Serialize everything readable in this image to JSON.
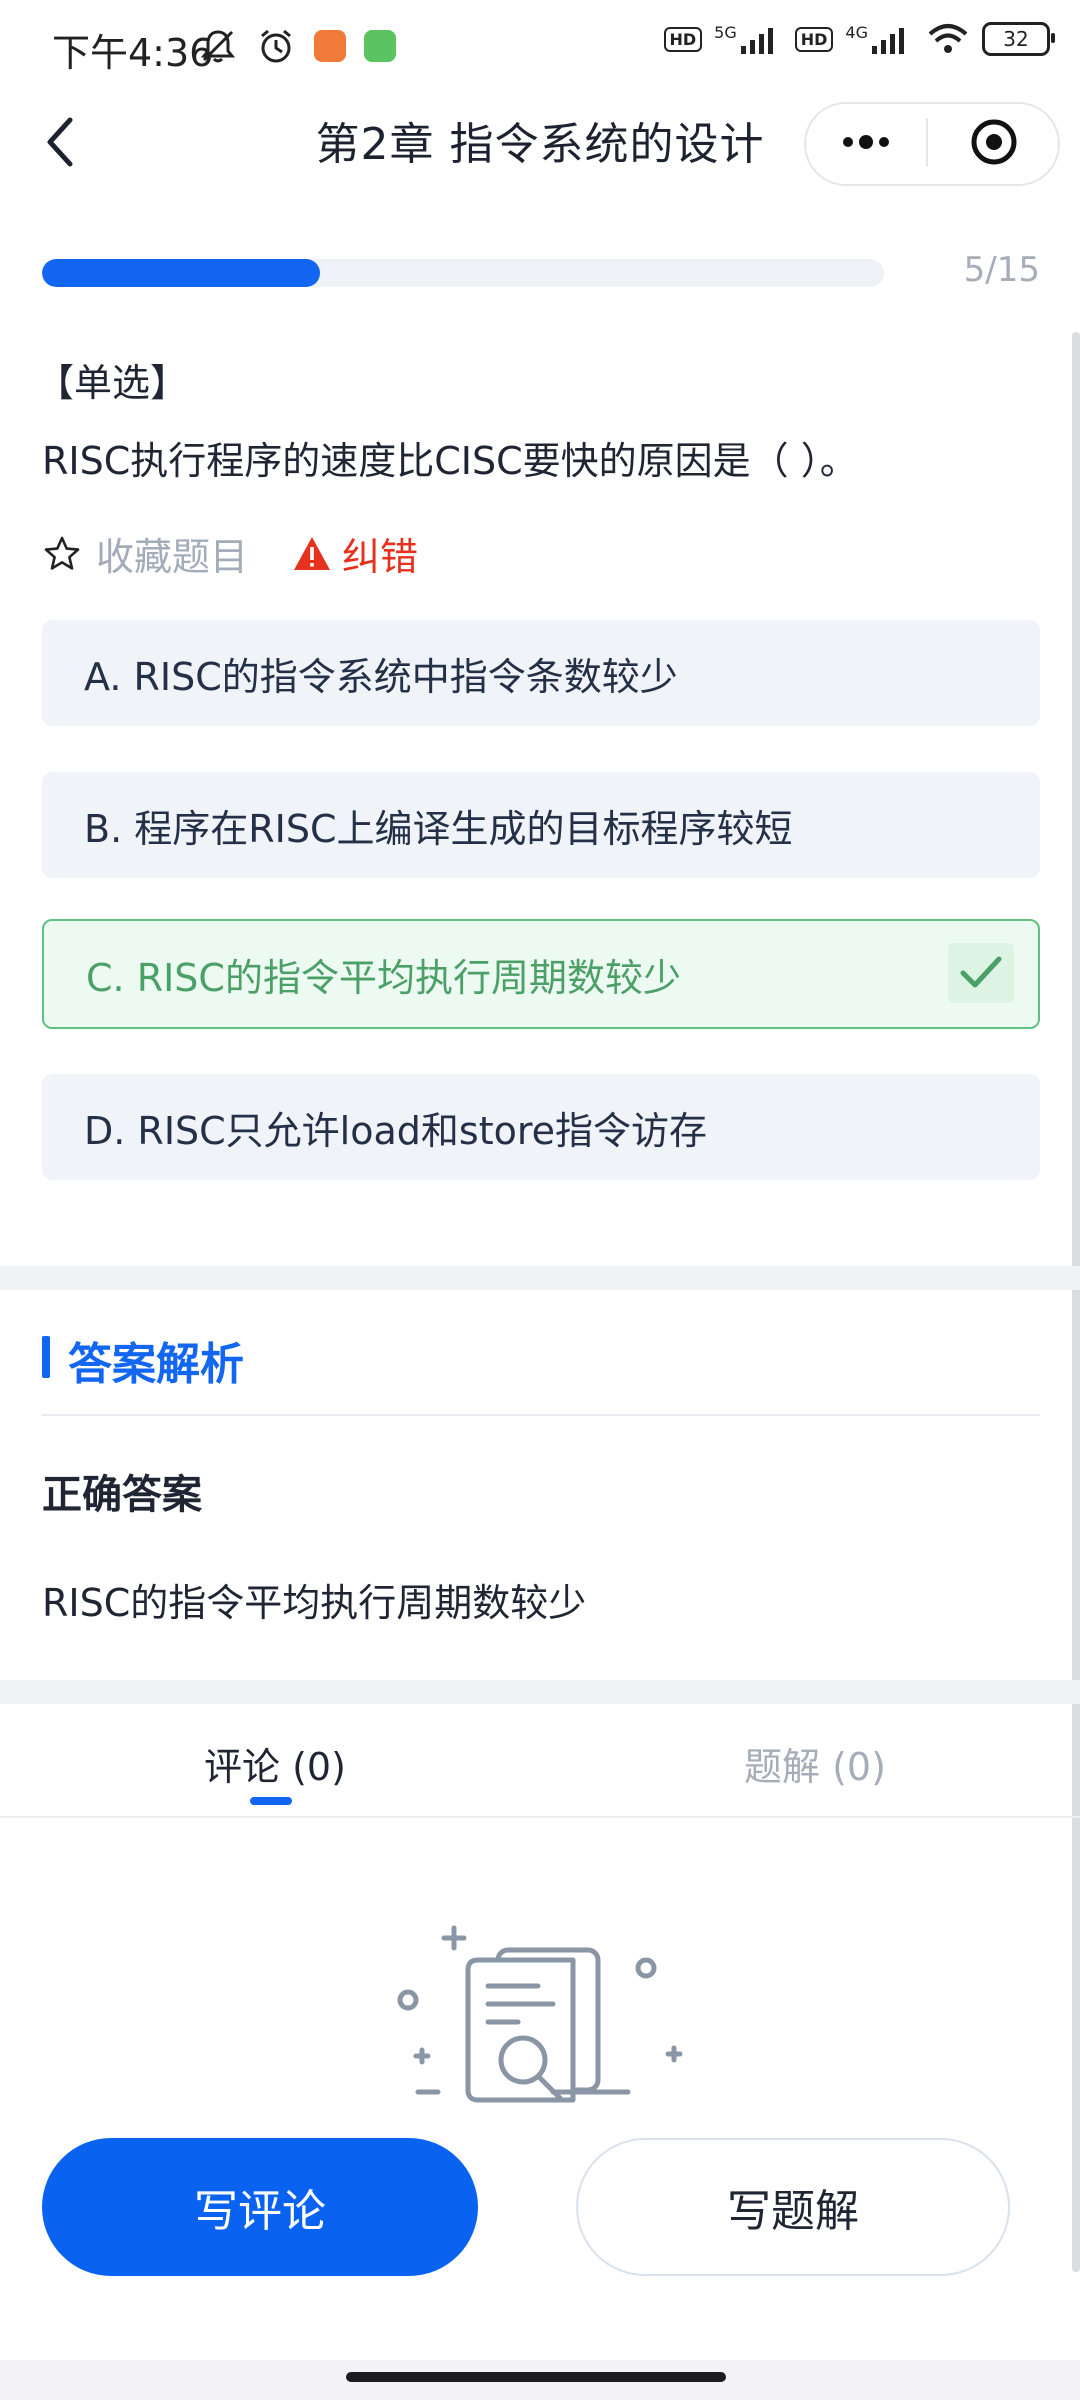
{
  "status_bar": {
    "time": "下午4:36",
    "net1": "5G",
    "net2": "4G",
    "hd": "HD",
    "battery": "32"
  },
  "nav": {
    "title": "第2章  指令系统的设计"
  },
  "progress": {
    "current": 5,
    "total": 15,
    "label": "5/15",
    "fill_fraction": 0.33
  },
  "question": {
    "type_label": "【单选】",
    "text": "RISC执行程序的速度比CISC要快的原因是（   ）。",
    "favorite_label": "收藏题目",
    "report_label": "纠错",
    "options": [
      {
        "label": "A. RISC的指令系统中指令条数较少",
        "state": "normal"
      },
      {
        "label": "B. 程序在RISC上编译生成的目标程序较短",
        "state": "normal"
      },
      {
        "label": "C. RISC的指令平均执行周期数较少",
        "state": "correct"
      },
      {
        "label": "D. RISC只允许load和store指令访存",
        "state": "normal"
      }
    ]
  },
  "analysis": {
    "title": "答案解析",
    "correct_label": "正确答案",
    "correct_text": "RISC的指令平均执行周期数较少"
  },
  "tabs": [
    {
      "label": "评论 (0)",
      "active": true
    },
    {
      "label": "题解 (0)",
      "active": false
    }
  ],
  "buttons": {
    "write_comment": "写评论",
    "write_solution": "写题解"
  },
  "colors": {
    "accent": "#1266f1",
    "correct": "#4ba068",
    "error": "#e4321f",
    "muted": "#a3acba"
  }
}
